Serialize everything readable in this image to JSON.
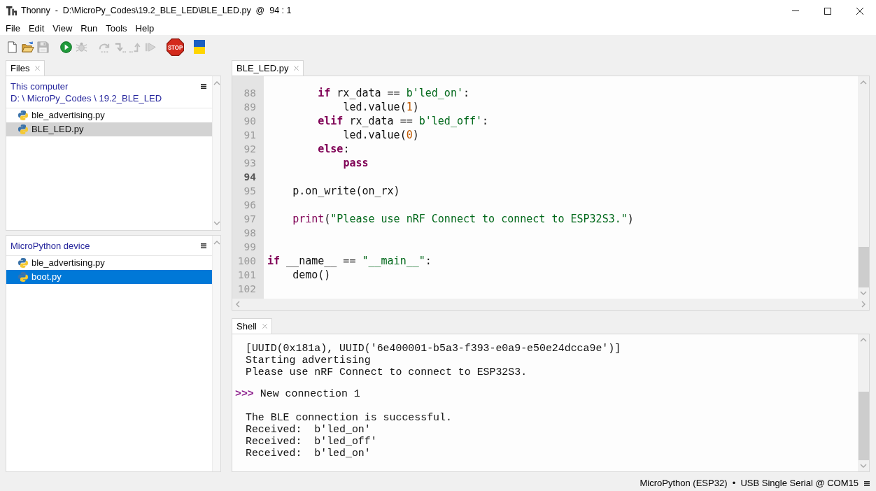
{
  "window": {
    "title": "Thonny  -  D:\\MicroPy_Codes\\19.2_BLE_LED\\BLE_LED.py  @  94 : 1"
  },
  "menu": [
    "File",
    "Edit",
    "View",
    "Run",
    "Tools",
    "Help"
  ],
  "toolbar": [
    [
      {
        "kind": "new",
        "disabled": false
      },
      {
        "kind": "open",
        "disabled": false
      },
      {
        "kind": "save",
        "disabled": true
      }
    ],
    [
      {
        "kind": "run",
        "disabled": false
      },
      {
        "kind": "debug",
        "disabled": true
      }
    ],
    [
      {
        "kind": "step_over",
        "disabled": true
      },
      {
        "kind": "step_into",
        "disabled": true
      },
      {
        "kind": "step_out",
        "disabled": true
      },
      {
        "kind": "resume",
        "disabled": true
      }
    ],
    [
      {
        "kind": "stop",
        "disabled": false,
        "label": "STOP"
      }
    ],
    [
      {
        "kind": "flag",
        "disabled": false
      }
    ]
  ],
  "files": {
    "tabs": [
      {
        "label": "Files",
        "selected": true
      }
    ],
    "sections": [
      {
        "title": "This computer",
        "path": "D: \\ MicroPy_Codes \\ 19.2_BLE_LED",
        "focused": false,
        "items": [
          {
            "name": "ble_advertising.py",
            "selected": false
          },
          {
            "name": "BLE_LED.py",
            "selected": true
          }
        ]
      },
      {
        "title": "MicroPython device",
        "focused": true,
        "items": [
          {
            "name": "ble_advertising.py",
            "selected": false
          },
          {
            "name": "boot.py",
            "selected": true
          }
        ]
      }
    ]
  },
  "editor": {
    "tabs": [
      {
        "label": "BLE_LED.py",
        "selected": true
      }
    ],
    "lines": [
      {
        "number": "88",
        "current": false,
        "tokens": [
          {
            "kind": "keyword",
            "text": "        if"
          },
          {
            "kind": "plain",
            "text": " rx_data == "
          },
          {
            "kind": "string",
            "text": "b'led_on'"
          },
          {
            "kind": "plain",
            "text": ":"
          }
        ]
      },
      {
        "number": "89",
        "current": false,
        "tokens": [
          {
            "kind": "plain",
            "text": "            led.value("
          },
          {
            "kind": "number",
            "text": "1"
          },
          {
            "kind": "plain",
            "text": ")"
          }
        ]
      },
      {
        "number": "90",
        "current": false,
        "tokens": [
          {
            "kind": "keyword",
            "text": "        elif"
          },
          {
            "kind": "plain",
            "text": " rx_data == "
          },
          {
            "kind": "string",
            "text": "b'led_off'"
          },
          {
            "kind": "plain",
            "text": ":"
          }
        ]
      },
      {
        "number": "91",
        "current": false,
        "tokens": [
          {
            "kind": "plain",
            "text": "            led.value("
          },
          {
            "kind": "number",
            "text": "0"
          },
          {
            "kind": "plain",
            "text": ")"
          }
        ]
      },
      {
        "number": "92",
        "current": false,
        "tokens": [
          {
            "kind": "keyword",
            "text": "        else"
          },
          {
            "kind": "plain",
            "text": ":"
          }
        ]
      },
      {
        "number": "93",
        "current": false,
        "tokens": [
          {
            "kind": "keyword",
            "text": "            pass"
          }
        ]
      },
      {
        "number": "94",
        "current": true
      },
      {
        "number": "95",
        "current": false,
        "tokens": [
          {
            "kind": "plain",
            "text": "    p.on_write(on_rx)"
          }
        ]
      },
      {
        "number": "96",
        "current": false
      },
      {
        "number": "97",
        "current": false,
        "tokens": [
          {
            "kind": "builtin",
            "text": "    print"
          },
          {
            "kind": "plain",
            "text": "("
          },
          {
            "kind": "string",
            "text": "\"Please use nRF Connect to connect to ESP32S3.\""
          },
          {
            "kind": "plain",
            "text": ")"
          }
        ]
      },
      {
        "number": "98",
        "current": false
      },
      {
        "number": "99",
        "current": false
      },
      {
        "number": "100",
        "current": false,
        "tokens": [
          {
            "kind": "keyword",
            "text": "if"
          },
          {
            "kind": "plain",
            "text": " __name__ == "
          },
          {
            "kind": "string",
            "text": "\"__main__\""
          },
          {
            "kind": "plain",
            "text": ":"
          }
        ]
      },
      {
        "number": "101",
        "current": false,
        "tokens": [
          {
            "kind": "plain",
            "text": "    demo()"
          }
        ]
      },
      {
        "number": "102",
        "current": false
      }
    ]
  },
  "shell": {
    "tabs": [
      {
        "label": "Shell",
        "selected": true
      }
    ],
    "lines": [
      {
        "kind": "output",
        "text": "[UUID(0x181a), UUID('6e400001-b5a3-f393-e0a9-e50e24dcca9e')]"
      },
      {
        "kind": "output",
        "text": "Starting advertising"
      },
      {
        "kind": "output",
        "text": "Please use nRF Connect to connect to ESP32S3."
      },
      {
        "kind": "prompt",
        "prompt": ">>>",
        "text": "New connection 1"
      },
      {
        "kind": "output",
        "text": "The BLE connection is successful."
      },
      {
        "kind": "output",
        "text": "Received:  b'led_on'"
      },
      {
        "kind": "output",
        "text": "Received:  b'led_off'"
      },
      {
        "kind": "output",
        "text": "Received:  b'led_on'"
      }
    ]
  },
  "status_bar": {
    "text": "MicroPython (ESP32)  •  USB Single Serial @ COM15"
  }
}
